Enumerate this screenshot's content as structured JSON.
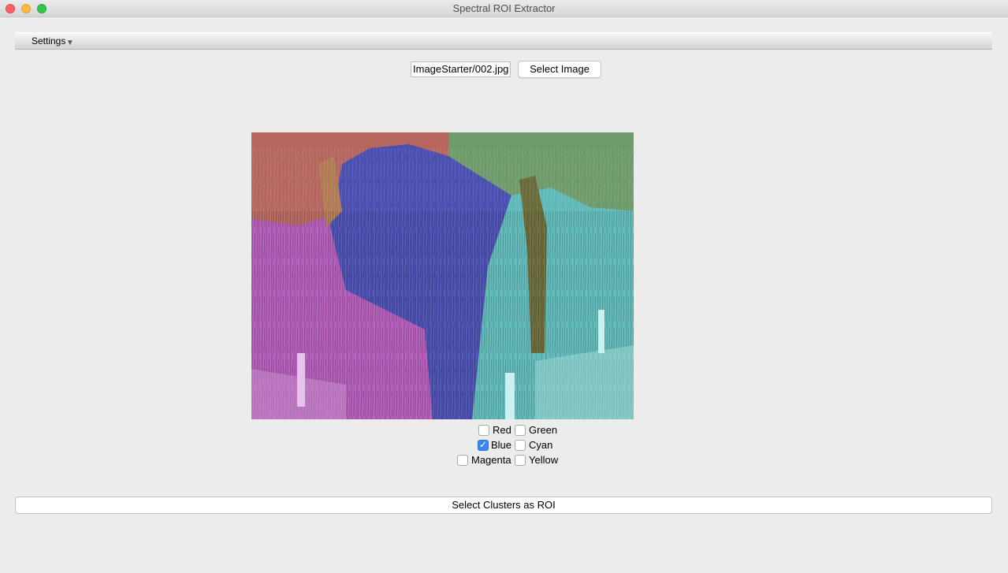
{
  "window": {
    "title": "Spectral ROI Extractor"
  },
  "menu": {
    "settings_label": "Settings",
    "settings_arrow": "▼"
  },
  "file": {
    "path_value": "ImageStarter/002.jpg",
    "select_button_label": "Select Image"
  },
  "image": {
    "description_icon": "segmented-wheat-field-image"
  },
  "clusters": {
    "left": [
      {
        "label": "Red",
        "checked": false
      },
      {
        "label": "Blue",
        "checked": true
      },
      {
        "label": "Magenta",
        "checked": false
      }
    ],
    "right": [
      {
        "label": "Green",
        "checked": false
      },
      {
        "label": "Cyan",
        "checked": false
      },
      {
        "label": "Yellow",
        "checked": false
      }
    ]
  },
  "actions": {
    "roi_button_label": "Select Clusters as ROI"
  },
  "colors": {
    "accent": "#3a86f7",
    "cluster_red": "#b5665f",
    "cluster_green": "#6f9a6c",
    "cluster_blue": "#4a4fb0",
    "cluster_magenta": "#b25bb8",
    "cluster_cyan": "#5fb9b8",
    "cluster_yellow": "#6b6a3a"
  }
}
